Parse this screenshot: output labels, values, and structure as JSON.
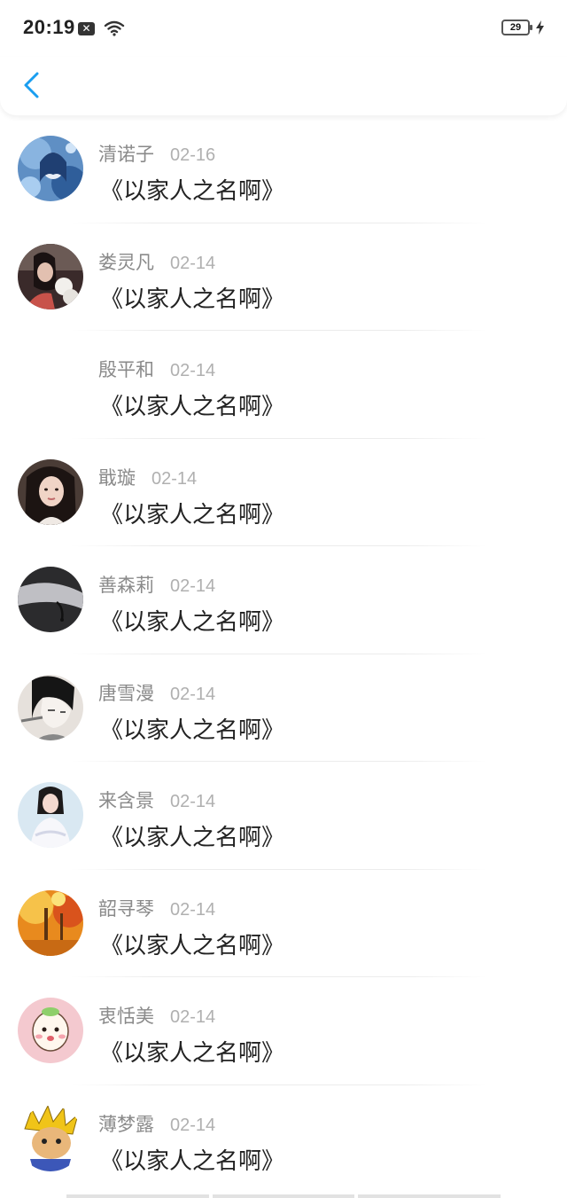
{
  "status_bar": {
    "time": "20:19",
    "battery_level": "29"
  },
  "header": {
    "back_icon": "chevron-left-icon",
    "accent_color": "#1a9ef0"
  },
  "comments": [
    {
      "name": "清诺子",
      "date": "02-16",
      "content": "《以家人之名啊》",
      "avatar": "anime-girl-blue"
    },
    {
      "name": "娄灵凡",
      "date": "02-14",
      "content": "《以家人之名啊》",
      "avatar": "girl-with-dog"
    },
    {
      "name": "殷平和",
      "date": "02-14",
      "content": "《以家人之名啊》",
      "avatar": "none"
    },
    {
      "name": "戢璇",
      "date": "02-14",
      "content": "《以家人之名啊》",
      "avatar": "girl-portrait"
    },
    {
      "name": "善森莉",
      "date": "02-14",
      "content": "《以家人之名啊》",
      "avatar": "hand-dark"
    },
    {
      "name": "唐雪漫",
      "date": "02-14",
      "content": "《以家人之名啊》",
      "avatar": "manga-boy"
    },
    {
      "name": "来含景",
      "date": "02-14",
      "content": "《以家人之名啊》",
      "avatar": "girl-white-dress"
    },
    {
      "name": "韶寻琴",
      "date": "02-14",
      "content": "《以家人之名啊》",
      "avatar": "autumn-trees"
    },
    {
      "name": "衷恬美",
      "date": "02-14",
      "content": "《以家人之名啊》",
      "avatar": "cartoon-baby-pink"
    },
    {
      "name": "薄梦露",
      "date": "02-14",
      "content": "《以家人之名啊》",
      "avatar": "cartoon-yellow-hair"
    }
  ]
}
